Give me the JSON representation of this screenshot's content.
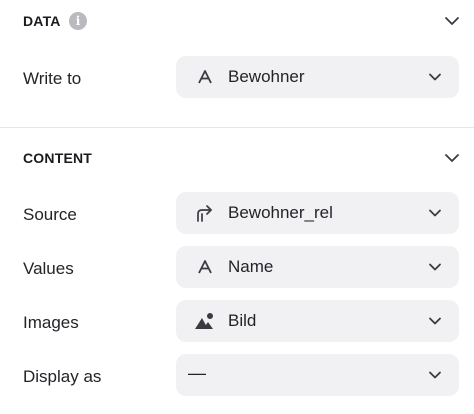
{
  "data_section": {
    "title": "DATA",
    "info_glyph": "i",
    "rows": [
      {
        "label": "Write to",
        "value": "Bewohner",
        "icon": "text-a-icon"
      }
    ]
  },
  "content_section": {
    "title": "CONTENT",
    "rows": [
      {
        "label": "Source",
        "value": "Bewohner_rel",
        "icon": "relation-arrow-icon"
      },
      {
        "label": "Values",
        "value": "Name",
        "icon": "text-a-icon"
      },
      {
        "label": "Images",
        "value": "Bild",
        "icon": "image-icon"
      },
      {
        "label": "Display as",
        "value": "—",
        "icon": ""
      }
    ]
  }
}
